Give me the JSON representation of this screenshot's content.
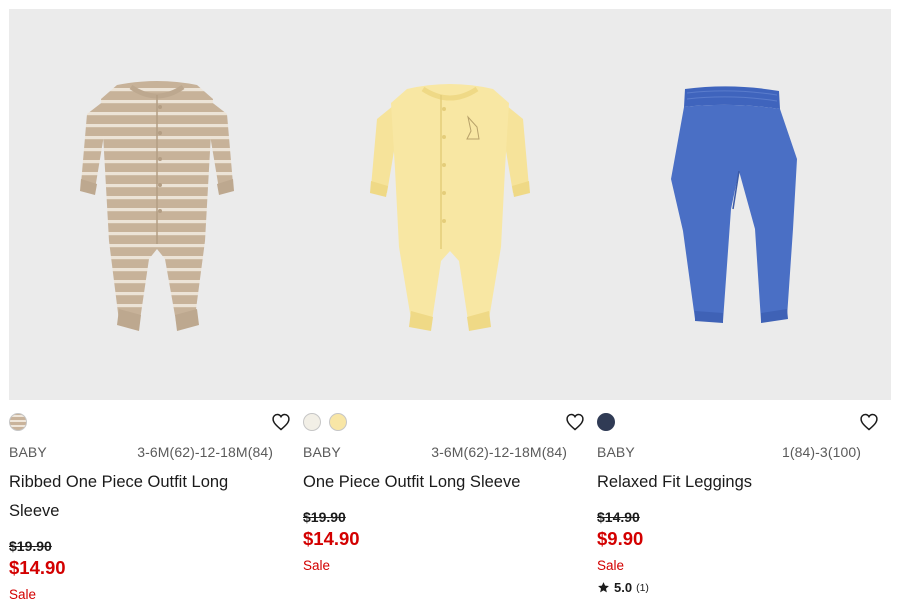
{
  "products": [
    {
      "category": "BABY",
      "sizes": "3-6M(62)-12-18M(84)",
      "name": "Ribbed One Piece Outfit Long Sleeve",
      "original_price": "$19.90",
      "sale_price": "$14.90",
      "badge": "Sale",
      "swatches": [
        "#c9b39b"
      ],
      "image_icon": "striped-beige-romper"
    },
    {
      "category": "BABY",
      "sizes": "3-6M(62)-12-18M(84)",
      "name": "One Piece Outfit Long Sleeve",
      "original_price": "$19.90",
      "sale_price": "$14.90",
      "badge": "Sale",
      "swatches": [
        "#f2efe6",
        "#f8e6a6"
      ],
      "image_icon": "yellow-romper"
    },
    {
      "category": "BABY",
      "sizes": "1(84)-3(100)",
      "name": "Relaxed Fit Leggings",
      "original_price": "$14.90",
      "sale_price": "$9.90",
      "badge": "Sale",
      "rating": "5.0",
      "rating_count": "(1)",
      "swatches": [
        "#303b55"
      ],
      "image_icon": "blue-leggings"
    }
  ],
  "colors": {
    "sale_red": "#d30000",
    "image_background": "#ebebeb",
    "text": "#1b1b1b"
  }
}
